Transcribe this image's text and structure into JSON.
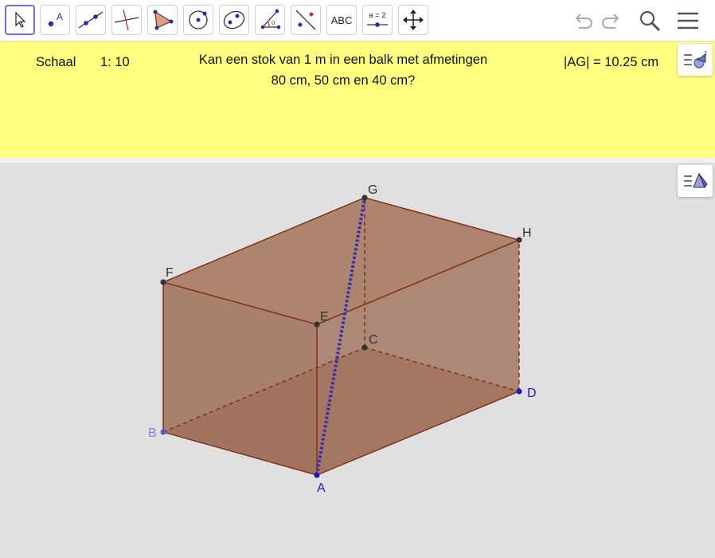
{
  "toolbar": {
    "tools": [
      {
        "name": "move-tool",
        "icon": "arrow-cursor-icon"
      },
      {
        "name": "point-tool",
        "icon": "point-icon",
        "label": "A"
      },
      {
        "name": "line-tool",
        "icon": "line-through-two-points-icon"
      },
      {
        "name": "perpendicular-line-tool",
        "icon": "perpendicular-line-icon"
      },
      {
        "name": "polygon-tool",
        "icon": "polygon-icon"
      },
      {
        "name": "circle-tool",
        "icon": "circle-center-point-icon"
      },
      {
        "name": "conic-tool",
        "icon": "ellipse-icon"
      },
      {
        "name": "angle-tool",
        "icon": "angle-icon"
      },
      {
        "name": "reflect-tool",
        "icon": "reflect-about-line-icon"
      },
      {
        "name": "text-tool",
        "icon": "text-icon",
        "label": "ABC"
      },
      {
        "name": "slider-tool",
        "icon": "slider-icon",
        "label": "a = 2"
      },
      {
        "name": "move-graphics-view-tool",
        "icon": "move-arrows-icon"
      }
    ],
    "undo_icon": "undo-icon",
    "redo_icon": "redo-icon",
    "search_icon": "search-icon",
    "menu_icon": "hamburger-menu-icon"
  },
  "graphics_view": {
    "background": "#ffff80",
    "scale_label": "Schaal",
    "scale_value": "1: 10",
    "question_line1": "Kan een stok van 1 m in een balk met afmetingen",
    "question_line2": "80 cm, 50 cm en 40 cm?",
    "measure": "|AG| = 10.25 cm",
    "style_bar_icon": "graphics-style-bar-icon"
  },
  "view3d": {
    "background": "#e0e0e0",
    "style_bar_icon": "3d-style-bar-icon",
    "box_face_color": "#a0705a",
    "edge_color": "#7a2c10",
    "diagonal_color": "#3030b0",
    "points": [
      {
        "label": "A",
        "color": "#1a1acc"
      },
      {
        "label": "B",
        "color": "#8080e0"
      },
      {
        "label": "C",
        "color": "#333333"
      },
      {
        "label": "D",
        "color": "#1a1acc"
      },
      {
        "label": "E",
        "color": "#333333"
      },
      {
        "label": "F",
        "color": "#333333"
      },
      {
        "label": "G",
        "color": "#333333"
      },
      {
        "label": "H",
        "color": "#333333"
      }
    ]
  }
}
